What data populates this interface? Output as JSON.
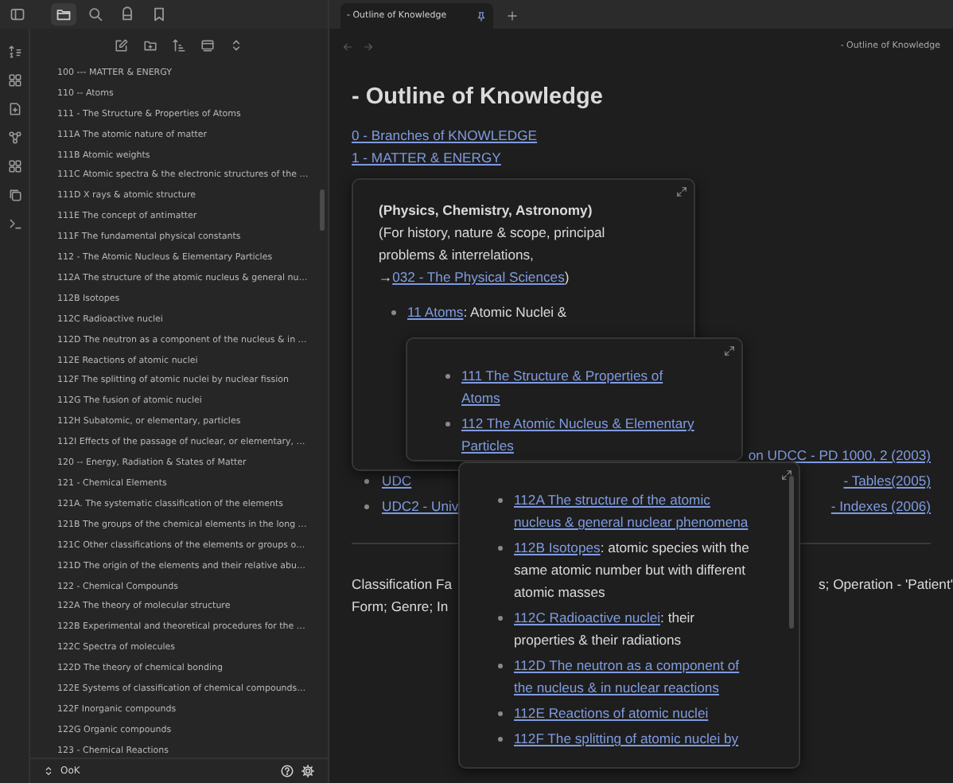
{
  "sidebar_tabs": [
    {
      "kind": "files",
      "selected": true
    },
    {
      "kind": "search",
      "selected": false
    },
    {
      "kind": "tags",
      "selected": false
    },
    {
      "kind": "bookmarks",
      "selected": false
    }
  ],
  "files": [
    "100 --- MATTER & ENERGY",
    "110 -- Atoms",
    "111 - The Structure & Properties of Atoms",
    "111A The atomic nature of matter",
    "111B Atomic weights",
    "111C Atomic spectra & the electronic structures of the …",
    "111D X rays & atomic structure",
    "111E The concept of antimatter",
    "111F The fundamental physical constants",
    "112 - The Atomic Nucleus & Elementary Particles",
    "112A The structure of the atomic nucleus & general nu…",
    "112B Isotopes",
    "112C Radioactive nuclei",
    "112D The neutron as a component of the nucleus & in …",
    "112E Reactions of atomic nuclei",
    "112F The splitting of atomic nuclei by nuclear fission",
    "112G The fusion of atomic nuclei",
    "112H Subatomic, or elementary, particles",
    "112I Effects of the passage of nuclear, or elementary, …",
    "120 -- Energy, Radiation & States of Matter",
    "121 - Chemical Elements",
    "121A. The systematic classification of the elements",
    "121B The groups of the chemical elements in the long …",
    "121C Other classifications of the elements or groups o…",
    "121D The origin of the elements and their relative abu…",
    "122 - Chemical Compounds",
    "122A The theory of molecular structure",
    "122B Experimental and theoretical procedures for the …",
    "122C Spectra of molecules",
    "122D The theory of chemical bonding",
    "122E Systems of classification of chemical compounds…",
    "122F Inorganic compounds",
    "122G Organic compounds",
    "123 - Chemical Reactions"
  ],
  "vault": {
    "name": "OoK"
  },
  "tabs": [
    {
      "title": "- Outline of Knowledge",
      "selected": true
    }
  ],
  "breadcrumb": "- Outline of Knowledge",
  "note": {
    "title": "- Outline of Knowledge",
    "links": [
      "0 - Branches of KNOWLEDGE",
      "1 - MATTER & ENERGY"
    ],
    "list_rows": [
      {
        "right": "on UDCC - PD 1000, 2 (2003)"
      },
      {
        "left": "UDC",
        "right": "- Tables(2005)"
      },
      {
        "left": "UDC2 - Univ",
        "right": "- Indexes (2006)"
      }
    ],
    "text_rows": [
      {
        "left": "Classification Fa",
        "right": "s; Operation - 'Patient'"
      },
      {
        "left": "Form; Genre; In"
      }
    ]
  },
  "popovers": [
    {
      "heading": "(Physics, Chemistry, Astronomy)",
      "text": "(For history, nature & scope, principal problems & interrelations, →",
      "link": "032 - The Physical Sciences",
      "text_after": ")",
      "items": [
        {
          "link": "11 Atoms",
          "text": ": Atomic Nuclei &"
        }
      ]
    },
    {
      "items": [
        {
          "link": "111 The Structure & Properties of Atoms"
        },
        {
          "link": "112 The Atomic Nucleus & Elementary Particles"
        }
      ]
    },
    {
      "scrollbar": true,
      "items": [
        {
          "link": "112A The structure of the atomic nucleus & general nuclear phenomena"
        },
        {
          "link": "112B Isotopes",
          "text": ": atomic species with the same atomic number but with different atomic masses"
        },
        {
          "link": "112C Radioactive nuclei",
          "text": ": their properties & their radiations"
        },
        {
          "link": "112D The neutron as a component of the nucleus & in nuclear reactions"
        },
        {
          "link": "112E Reactions of atomic nuclei"
        },
        {
          "link": "112F The splitting of atomic nuclei by"
        }
      ]
    }
  ]
}
